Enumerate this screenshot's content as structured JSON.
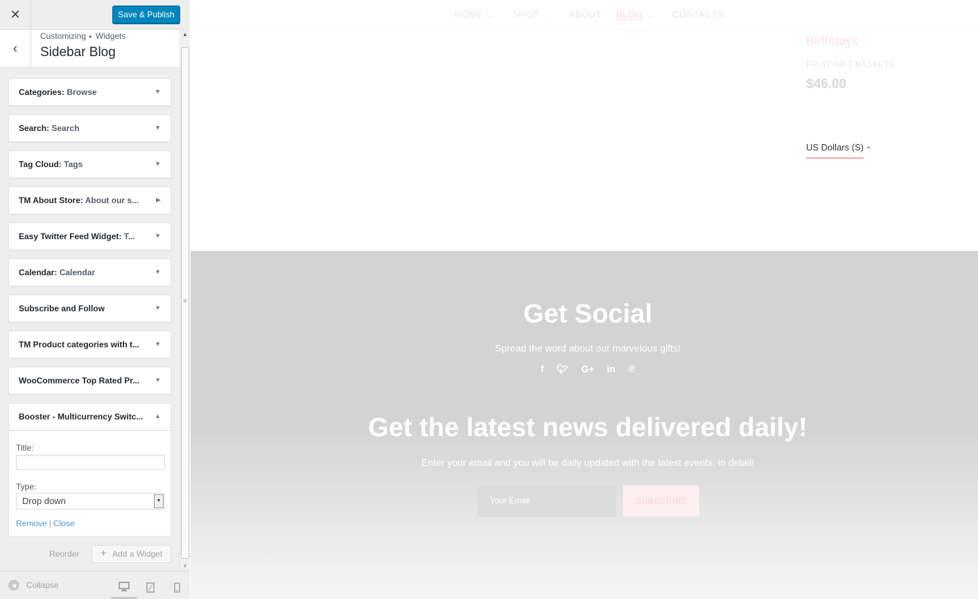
{
  "sidebar": {
    "close_icon": "close-icon",
    "save_label": "Save & Publish",
    "breadcrumb": {
      "root": "Customizing",
      "parent": "Widgets"
    },
    "section_title": "Sidebar Blog",
    "widgets": [
      {
        "name": "Categories",
        "sub": "Browse",
        "state": "collapsed"
      },
      {
        "name": "Search",
        "sub": "Search",
        "state": "collapsed"
      },
      {
        "name": "Tag Cloud",
        "sub": "Tags",
        "state": "collapsed"
      },
      {
        "name": "TM About Store",
        "sub": "About our s...",
        "state": "collapsed-right"
      },
      {
        "name": "Easy Twitter Feed Widget",
        "sub": "T...",
        "state": "collapsed"
      },
      {
        "name": "Calendar",
        "sub": "Calendar",
        "state": "collapsed"
      },
      {
        "name": "Subscribe and Follow",
        "sub": "",
        "state": "collapsed"
      },
      {
        "name": "TM Product categories with t...",
        "sub": "",
        "state": "collapsed"
      },
      {
        "name": "WooCommerce Top Rated Pr...",
        "sub": "",
        "state": "collapsed"
      },
      {
        "name": "Booster - Multicurrency Switc...",
        "sub": "",
        "state": "expanded"
      }
    ],
    "booster_form": {
      "title_label": "Title:",
      "title_value": "",
      "type_label": "Type:",
      "type_value": "Drop down",
      "remove_label": "Remove",
      "separator": "|",
      "close_label": "Close"
    },
    "reorder_label": "Reorder",
    "add_widget_label": "Add a Widget",
    "collapse_label": "Collapse"
  },
  "preview": {
    "nav": [
      {
        "label": "HOME",
        "dropdown": true
      },
      {
        "label": "SHOP",
        "dropdown": true
      },
      {
        "label": "ABOUT",
        "dropdown": false
      },
      {
        "label": "BLOG",
        "dropdown": true
      },
      {
        "label": "CONTACTS",
        "dropdown": false
      }
    ],
    "product": {
      "category": "Birthdays",
      "name": "FRUIT GIFT BASKETS",
      "price": "$46.00"
    },
    "currency_switcher": "US Dollars (S)",
    "social": {
      "title": "Get Social",
      "description": "Spread the word about our marvelous gifts!",
      "icons": [
        "facebook-icon",
        "twitter-icon",
        "google-plus-icon",
        "linkedin-icon",
        "pinterest-icon"
      ]
    },
    "newsletter": {
      "title": "Get the latest news delivered daily!",
      "description": "Enter your email and you will be daily updated with the latest events, in detail!",
      "email_placeholder": "Your Email",
      "subscribe_label": "SUBSCRIBE"
    }
  },
  "colors": {
    "primary_button": "#0085ba",
    "accent_pink": "#f1a8b8",
    "footer_gray": "#d3d3d3"
  }
}
